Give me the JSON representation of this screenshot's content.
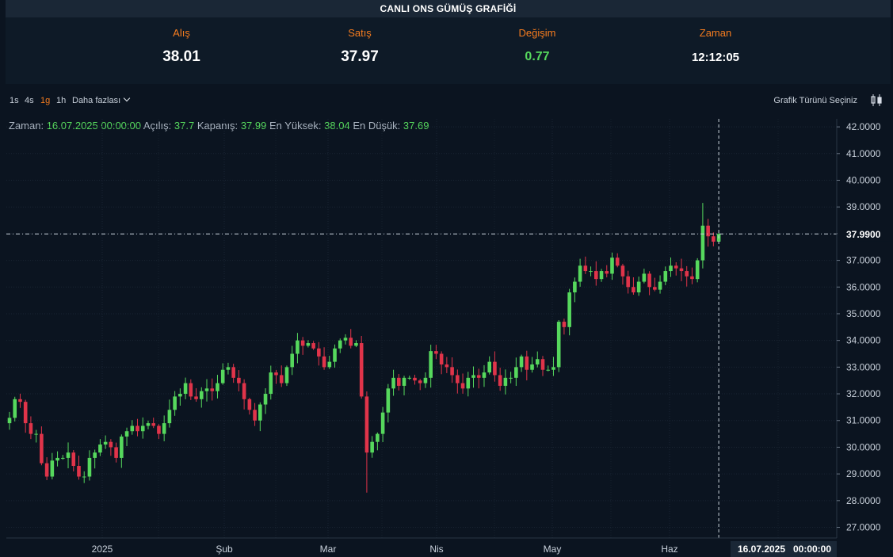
{
  "header": {
    "title": "CANLI ONS GÜMÜŞ GRAFİĞİ"
  },
  "stats": {
    "buy": {
      "label": "Alış",
      "value": "38.01"
    },
    "sell": {
      "label": "Satış",
      "value": "37.97"
    },
    "change": {
      "label": "Değişim",
      "value": "0.77"
    },
    "time": {
      "label": "Zaman",
      "value": "12:12:05"
    }
  },
  "toolbar": {
    "timeframes": [
      "1s",
      "4s",
      "1g",
      "1h"
    ],
    "active_timeframe": "1g",
    "more_label": "Daha fazlası",
    "chart_type_label": "Grafik Türünü Seçiniz",
    "chart_type_icon": "candlestick-icon"
  },
  "ohlc": {
    "time_label": "Zaman:",
    "time_value": "16.07.2025 00:00:00",
    "open_label": "Açılış:",
    "open_value": "37.7",
    "close_label": "Kapanış:",
    "close_value": "37.99",
    "high_label": "En Yüksek:",
    "high_value": "38.04",
    "low_label": "En Düşük:",
    "low_value": "37.69"
  },
  "colors": {
    "up": "#56d85d",
    "down": "#e0344a",
    "accent": "#f57c1f",
    "background": "#0b1420"
  },
  "chart_data": {
    "type": "candlestick",
    "ylim": [
      26.6,
      42.3
    ],
    "yticks": [
      "42.0000",
      "41.0000",
      "40.0000",
      "39.0000",
      "38.0000",
      "37.0000",
      "36.0000",
      "35.0000",
      "34.0000",
      "33.0000",
      "32.0000",
      "31.0000",
      "30.0000",
      "29.0000",
      "28.0000",
      "27.0000"
    ],
    "x_labels": [
      {
        "label": "2025",
        "date": "2025-01-01"
      },
      {
        "label": "Şub",
        "date": "2025-02-01"
      },
      {
        "label": "Mar",
        "date": "2025-03-01"
      },
      {
        "label": "Nis",
        "date": "2025-04-01"
      },
      {
        "label": "May",
        "date": "2025-05-01"
      },
      {
        "label": "Haz",
        "date": "2025-06-01"
      }
    ],
    "current_price": "37.9900",
    "crosshair_date_label": "16.07.2025",
    "crosshair_time_label": "00:00:00",
    "grid": true,
    "closes": [
      31.1,
      31.8,
      31.7,
      30.9,
      30.5,
      30.5,
      29.4,
      28.9,
      29.5,
      29.6,
      29.6,
      29.8,
      29.3,
      28.9,
      28.9,
      29.6,
      29.8,
      30.1,
      30.2,
      30.0,
      29.6,
      30.4,
      30.6,
      30.8,
      30.6,
      30.8,
      30.9,
      30.8,
      30.5,
      30.9,
      31.4,
      31.9,
      32.0,
      32.4,
      31.9,
      31.8,
      32.1,
      32.2,
      32.1,
      32.4,
      32.9,
      33.0,
      32.6,
      32.4,
      31.8,
      31.4,
      31.0,
      31.6,
      32.0,
      32.8,
      32.7,
      32.4,
      33.0,
      33.5,
      34.0,
      33.8,
      33.9,
      33.7,
      33.4,
      33.0,
      33.2,
      33.7,
      34.0,
      34.1,
      33.8,
      33.9,
      31.9,
      29.8,
      30.2,
      30.5,
      31.3,
      32.2,
      32.6,
      32.3,
      32.6,
      32.6,
      32.5,
      32.4,
      32.6,
      33.6,
      33.5,
      33.1,
      33.0,
      32.7,
      32.4,
      32.2,
      32.6,
      32.7,
      32.6,
      32.8,
      33.2,
      32.7,
      32.3,
      32.6,
      32.6,
      33.0,
      33.4,
      32.9,
      33.1,
      33.3,
      32.9,
      32.9,
      33.0,
      34.7,
      34.5,
      35.8,
      36.2,
      36.8,
      36.6,
      36.6,
      36.3,
      36.6,
      36.5,
      37.1,
      36.8,
      36.4,
      36.0,
      35.8,
      36.2,
      36.5,
      36.0,
      35.9,
      36.2,
      36.6,
      36.8,
      36.7,
      36.6,
      36.4,
      36.3,
      37.0,
      38.3,
      37.9,
      37.7,
      37.99
    ],
    "last_candle": {
      "date": "2025-07-16",
      "open": 37.7,
      "high": 38.04,
      "low": 37.69,
      "close": 37.99
    }
  }
}
